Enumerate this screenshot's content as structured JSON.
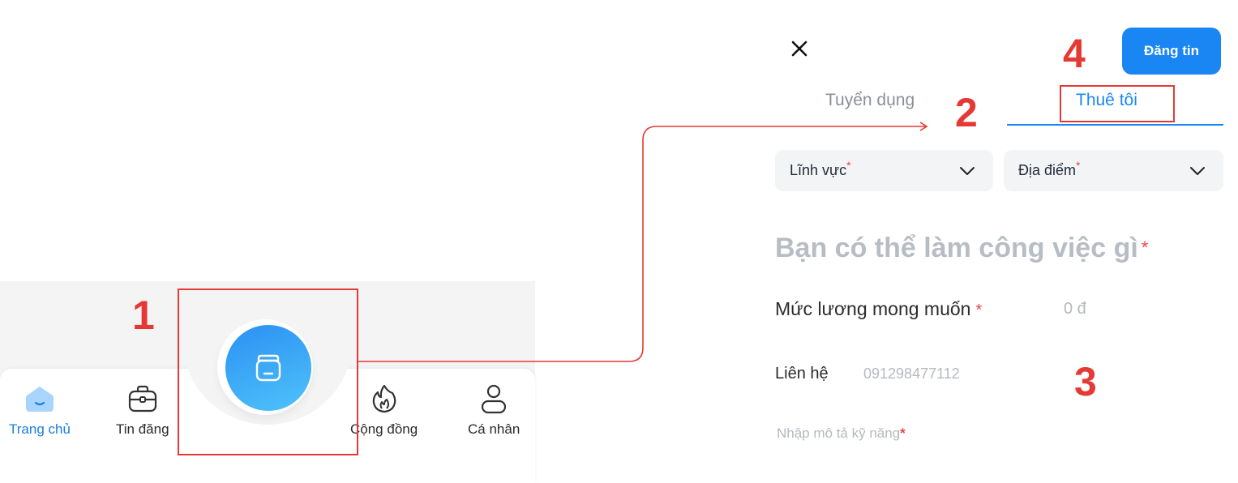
{
  "bottom_nav": {
    "items": [
      {
        "label": "Trang chủ",
        "icon": "home-icon",
        "active": true
      },
      {
        "label": "Tin đăng",
        "icon": "briefcase-icon",
        "active": false
      },
      {
        "label": "Cộng đồng",
        "icon": "flame-icon",
        "active": false
      },
      {
        "label": "Cá nhân",
        "icon": "user-icon",
        "active": false
      }
    ],
    "center_button": {
      "icon": "post-jar-icon"
    }
  },
  "form": {
    "close_icon": "close-icon",
    "post_button": "Đăng tin",
    "tabs": [
      {
        "label": "Tuyển dụng",
        "active": false
      },
      {
        "label": "Thuê tôi",
        "active": true
      }
    ],
    "selects": [
      {
        "label": "Lĩnh vực",
        "required_mark": "*"
      },
      {
        "label": "Địa điểm",
        "required_mark": "*"
      }
    ],
    "job_placeholder": "Bạn có thể làm công việc gì",
    "job_required_mark": "*",
    "salary": {
      "label": "Mức lương mong muốn",
      "required_mark": "*",
      "placeholder": "0 đ"
    },
    "contact": {
      "label": "Liên hệ",
      "value": "091298477112"
    },
    "description": {
      "placeholder": "Nhập mô tả kỹ năng",
      "required_mark": "*"
    }
  },
  "annotations": {
    "step_1": "1",
    "step_2": "2",
    "step_3": "3",
    "step_4": "4"
  },
  "colors": {
    "accent": "#1a86f3",
    "annotation": "#e53935",
    "placeholder": "#b8bcc4"
  }
}
